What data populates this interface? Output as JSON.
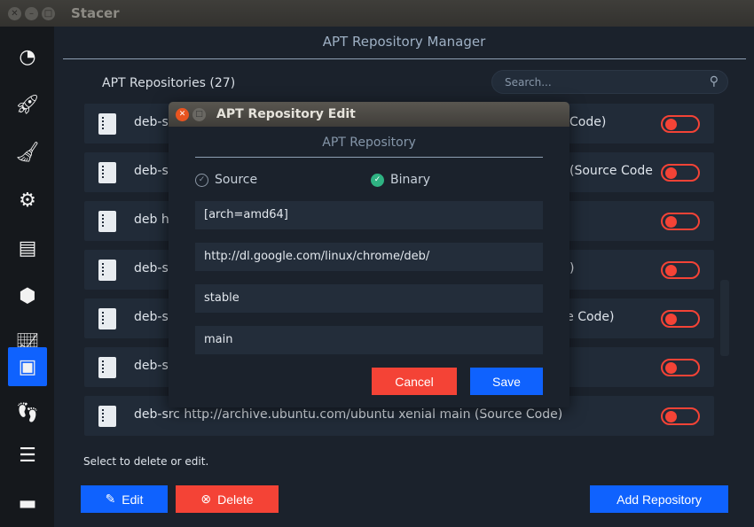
{
  "window": {
    "title": "Stacer"
  },
  "sidebar": {
    "items": [
      {
        "icon": "dashboard-icon"
      },
      {
        "icon": "rocket-icon"
      },
      {
        "icon": "broom-icon"
      },
      {
        "icon": "gears-icon"
      },
      {
        "icon": "processes-icon"
      },
      {
        "icon": "uninstaller-icon"
      },
      {
        "icon": "resources-icon"
      },
      {
        "icon": "package-icon",
        "active": true
      },
      {
        "icon": "gnome-icon"
      },
      {
        "icon": "settings-sliders-icon"
      },
      {
        "icon": "feedback-icon"
      }
    ]
  },
  "page": {
    "title": "APT Repository Manager",
    "count_label": "APT Repositories (27)",
    "search_placeholder": "Search...",
    "hint": "Select to delete or edit."
  },
  "rows": [
    {
      "left": "deb-s",
      "right": "Code)"
    },
    {
      "left": "deb-s",
      "right": "(Source Code"
    },
    {
      "left": "deb h",
      "right": ""
    },
    {
      "left": "deb-s",
      "right": ")"
    },
    {
      "left": "deb-s",
      "right": "rce Code)"
    },
    {
      "left": "deb-s",
      "right": ""
    },
    {
      "left": "deb-src http://archive.ubuntu.com/ubuntu xenial main (Source Code)",
      "right": ""
    }
  ],
  "buttons": {
    "edit": "Edit",
    "delete": "Delete",
    "add": "Add Repository"
  },
  "dialog": {
    "title": "APT Repository Edit",
    "subtitle": "APT Repository",
    "source_label": "Source",
    "binary_label": "Binary",
    "source_checked": false,
    "binary_checked": true,
    "fields": [
      "[arch=amd64]",
      "http://dl.google.com/linux/chrome/deb/",
      "stable",
      "main"
    ],
    "cancel": "Cancel",
    "save": "Save"
  },
  "colors": {
    "accent": "#0f62fe",
    "danger": "#f44336",
    "success": "#2fb383"
  }
}
